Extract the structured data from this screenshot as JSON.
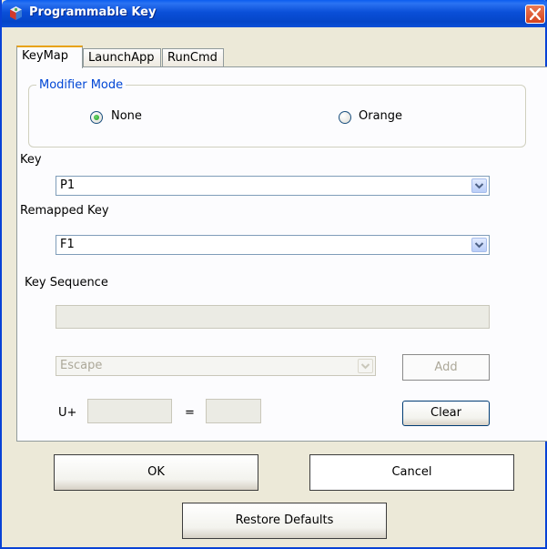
{
  "window": {
    "title": "Programmable Key",
    "icon": "app-cube-icon",
    "close_icon": "close-icon"
  },
  "tabs": [
    {
      "label": "KeyMap",
      "active": true
    },
    {
      "label": "LaunchApp",
      "active": false
    },
    {
      "label": "RunCmd",
      "active": false
    }
  ],
  "modifier_mode": {
    "legend": "Modifier Mode",
    "options": [
      {
        "label": "None",
        "selected": true
      },
      {
        "label": "Orange",
        "selected": false
      }
    ]
  },
  "key": {
    "label": "Key",
    "value": "P1"
  },
  "remapped_key": {
    "label": "Remapped Key",
    "value": "F1"
  },
  "key_sequence": {
    "label": "Key Sequence",
    "value": "",
    "key_select_value": "Escape",
    "add_label": "Add",
    "unicode_prefix": "U+",
    "unicode_value": "",
    "equals": "=",
    "char_value": "",
    "clear_label": "Clear"
  },
  "buttons": {
    "ok": "OK",
    "cancel": "Cancel",
    "restore": "Restore Defaults"
  },
  "colors": {
    "titlebar": "#0a4fd8",
    "accent_tab": "#e8a20f",
    "groupbox_legend": "#0046d5",
    "radio_selected": "#21a121"
  }
}
